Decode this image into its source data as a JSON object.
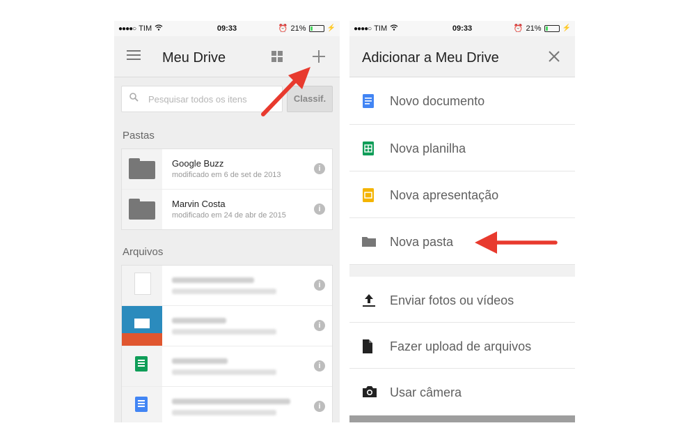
{
  "status_bar": {
    "carrier": "TIM",
    "time": "09:33",
    "battery": "21%",
    "battery_level": 0.21
  },
  "left_screen": {
    "title": "Meu Drive",
    "search": {
      "placeholder": "Pesquisar todos os itens"
    },
    "sort_label": "Classif.",
    "folders_heading": "Pastas",
    "folders": [
      {
        "name": "Google Buzz",
        "modified": "modificado em 6 de set de 2013"
      },
      {
        "name": "Marvin Costa",
        "modified": "modificado em 24 de abr de 2015"
      }
    ],
    "files_heading": "Arquivos"
  },
  "right_screen": {
    "title": "Adicionar a Meu Drive",
    "create_items": [
      {
        "label": "Novo documento",
        "icon": "doc-icon",
        "color": "#4285f4"
      },
      {
        "label": "Nova planilha",
        "icon": "sheet-icon",
        "color": "#0f9d58"
      },
      {
        "label": "Nova apresentação",
        "icon": "slides-icon",
        "color": "#f4b400"
      },
      {
        "label": "Nova pasta",
        "icon": "folder-icon",
        "color": "#777777"
      }
    ],
    "upload_items": [
      {
        "label": "Enviar fotos ou vídeos",
        "icon": "upload-icon"
      },
      {
        "label": "Fazer upload de arquivos",
        "icon": "file-icon"
      },
      {
        "label": "Usar câmera",
        "icon": "camera-icon"
      }
    ]
  },
  "annotations": {
    "arrow_color": "#e83a2e"
  }
}
